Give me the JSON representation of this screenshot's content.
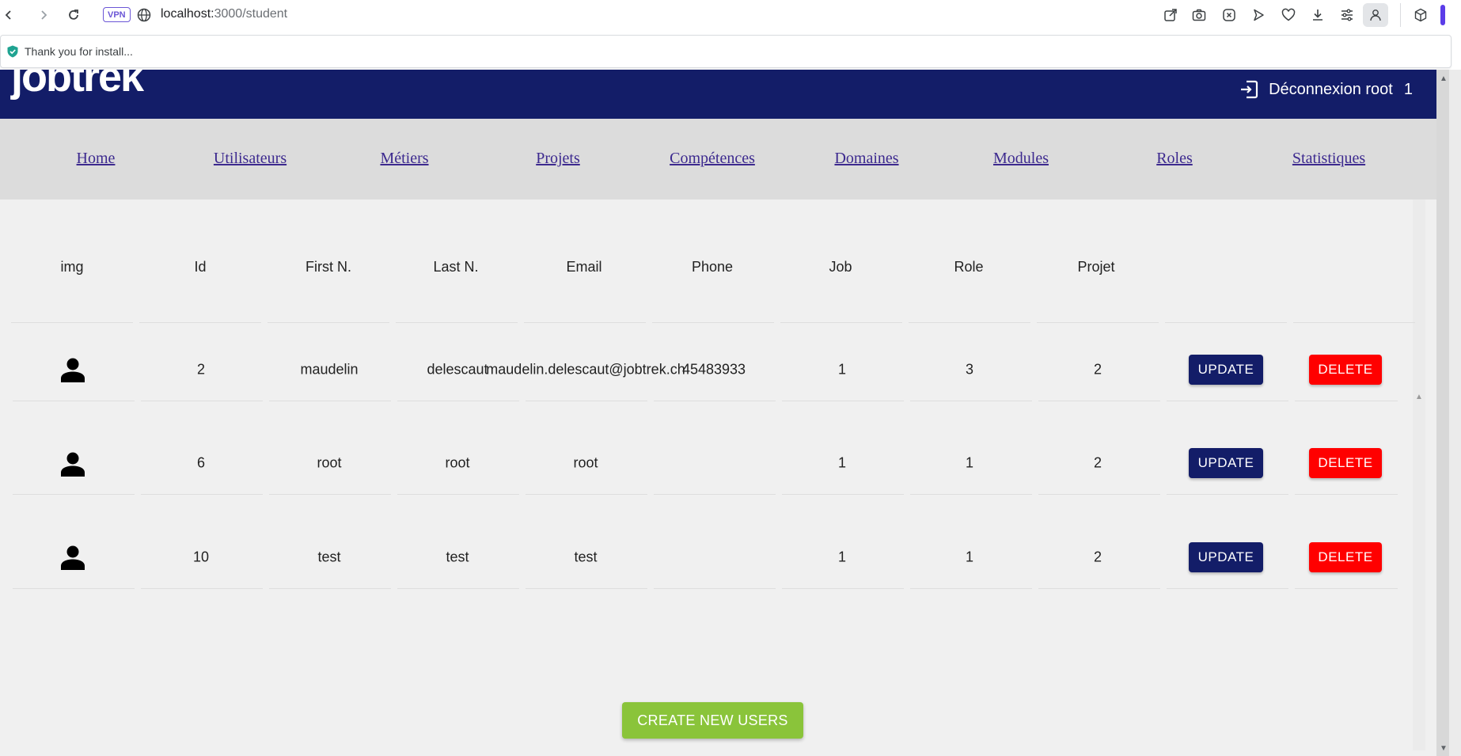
{
  "browser": {
    "url_host": "localhost:",
    "url_path": "3000/student",
    "vpn_label": "VPN",
    "notice_text": "Thank you for install...",
    "icons": [
      "back-icon",
      "forward-icon",
      "reload-icon",
      "globe-icon",
      "share-icon",
      "camera-icon",
      "close-box-icon",
      "play-icon",
      "heart-icon",
      "download-icon",
      "settings-sliders-icon",
      "profile-icon",
      "extensions-cube-icon"
    ]
  },
  "header": {
    "logo": "jobtrek",
    "logout_label": "Déconnexion root",
    "user_id": "1"
  },
  "nav": {
    "items": [
      {
        "label": "Home"
      },
      {
        "label": "Utilisateurs"
      },
      {
        "label": "Métiers"
      },
      {
        "label": "Projets"
      },
      {
        "label": "Compétences"
      },
      {
        "label": "Domaines"
      },
      {
        "label": "Modules"
      },
      {
        "label": "Roles"
      },
      {
        "label": "Statistiques"
      }
    ]
  },
  "table": {
    "columns": [
      "img",
      "Id",
      "First N.",
      "Last N.",
      "Email",
      "Phone",
      "Job",
      "Role",
      "Projet"
    ],
    "rows": [
      {
        "id": "2",
        "first": "maudelin",
        "last": "delescaut",
        "email": "maudelin.delescaut@jobtrek.ch",
        "phone": "45483933",
        "job": "1",
        "role": "3",
        "projet": "2"
      },
      {
        "id": "6",
        "first": "root",
        "last": "root",
        "email": "root",
        "phone": "",
        "job": "1",
        "role": "1",
        "projet": "2"
      },
      {
        "id": "10",
        "first": "test",
        "last": "test",
        "email": "test",
        "phone": "",
        "job": "1",
        "role": "1",
        "projet": "2"
      }
    ],
    "update_label": "UPDATE",
    "delete_label": "DELETE"
  },
  "create_button_label": "CREATE NEW USERS",
  "colors": {
    "header_bg": "#131d68",
    "nav_bg": "#dcdcdc",
    "update_bg": "#131d68",
    "delete_bg": "#ff0000",
    "create_bg": "#8ac43a",
    "link": "#3d2a8f"
  }
}
